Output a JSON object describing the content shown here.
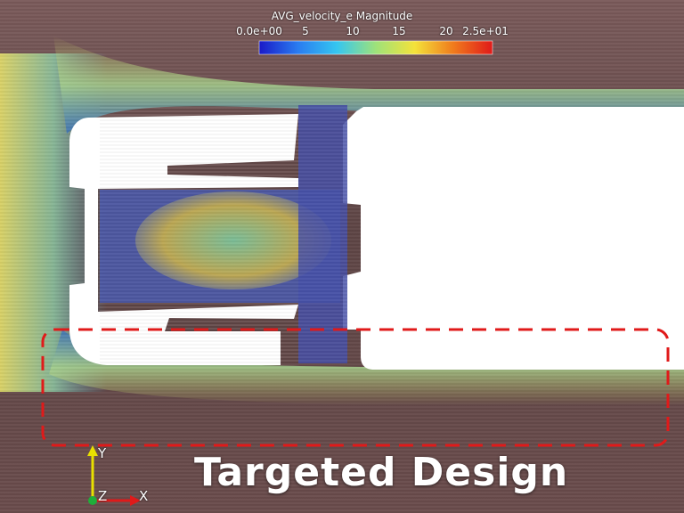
{
  "colorbar": {
    "title": "AVG_velocity_e Magnitude",
    "tick_labels": [
      "0.0e+00",
      "5",
      "10",
      "15",
      "20",
      "2.5e+01"
    ],
    "colors": [
      "#1a1ac8",
      "#2a7cf0",
      "#35c6f0",
      "#9ee27a",
      "#f4e23a",
      "#f07a1c",
      "#e01a1a"
    ]
  },
  "caption": "Targeted Design",
  "axes": {
    "y_label": "Y",
    "z_label": "Z",
    "x_label": "X",
    "y_color": "#e8e000",
    "x_color": "#e01a1a",
    "z_color": "#1fae3a"
  },
  "highlight_color": "#e01a1a"
}
